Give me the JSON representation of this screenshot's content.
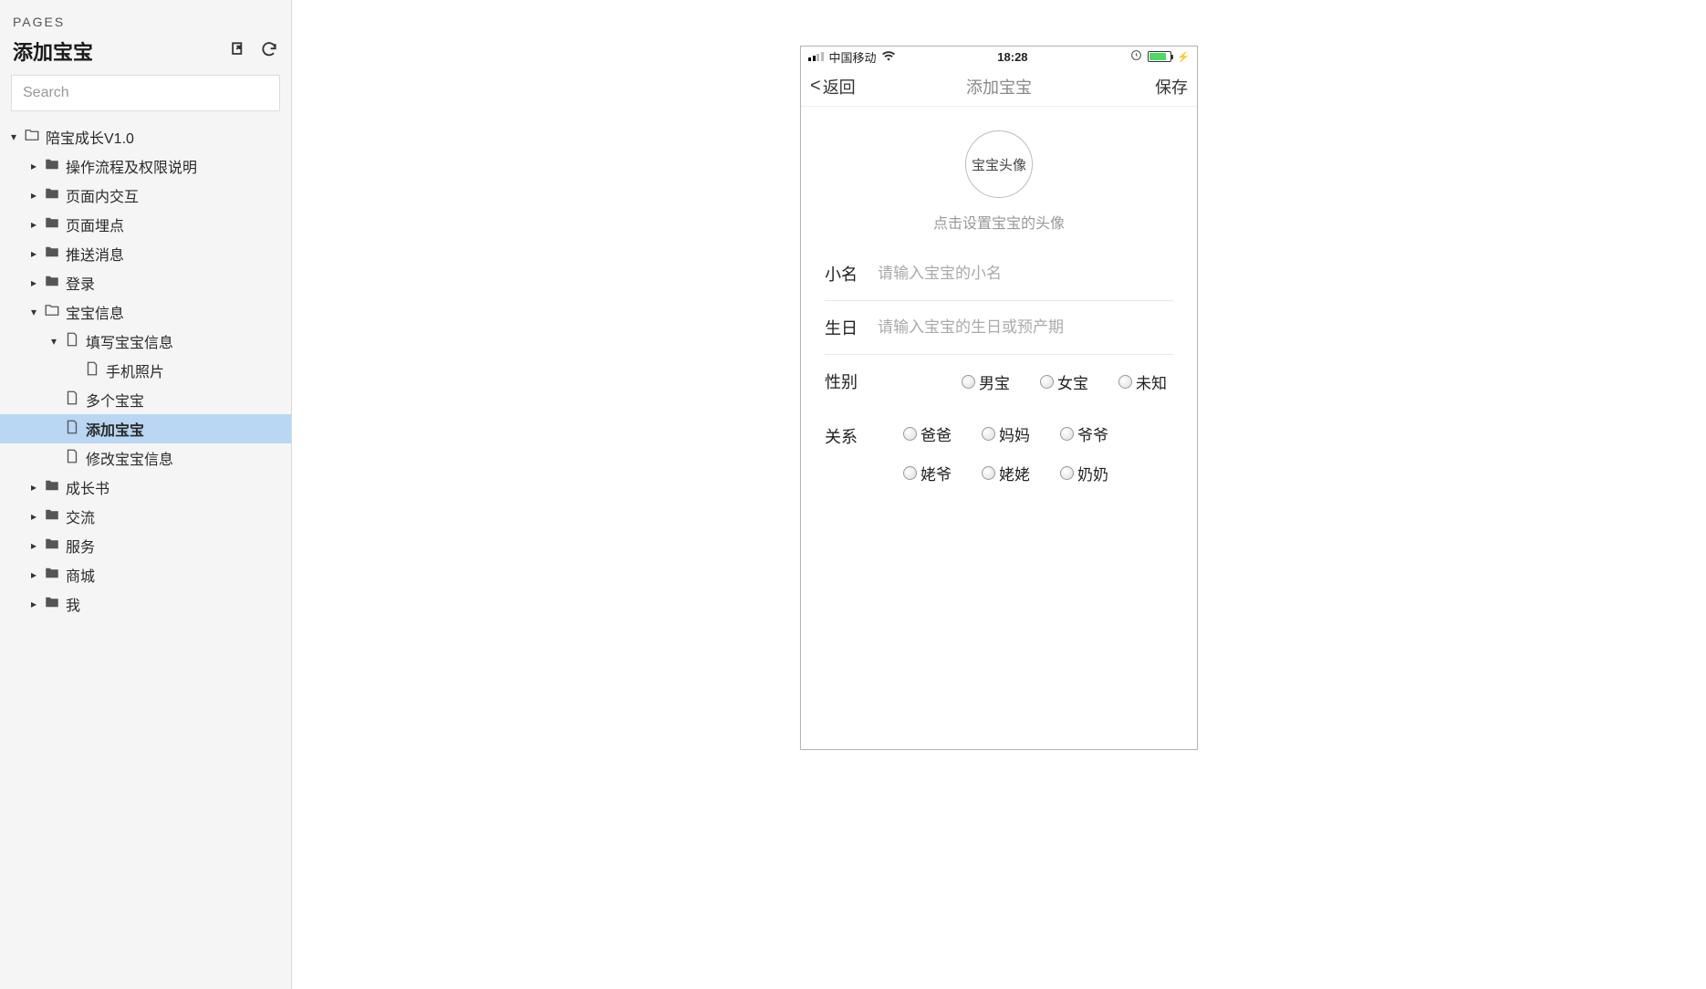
{
  "sidebar": {
    "pages_label": "PAGES",
    "page_title": "添加宝宝",
    "search_placeholder": "Search",
    "tree": [
      {
        "indent": 0,
        "caret": "down",
        "icon": "folder-outline",
        "label": "陪宝成长V1.0"
      },
      {
        "indent": 1,
        "caret": "right",
        "icon": "folder",
        "label": "操作流程及权限说明"
      },
      {
        "indent": 1,
        "caret": "right",
        "icon": "folder",
        "label": "页面内交互"
      },
      {
        "indent": 1,
        "caret": "right",
        "icon": "folder",
        "label": "页面埋点"
      },
      {
        "indent": 1,
        "caret": "right",
        "icon": "folder",
        "label": "推送消息"
      },
      {
        "indent": 1,
        "caret": "right",
        "icon": "folder",
        "label": "登录"
      },
      {
        "indent": 1,
        "caret": "down",
        "icon": "folder-outline",
        "label": "宝宝信息"
      },
      {
        "indent": 2,
        "caret": "down",
        "icon": "page",
        "label": "填写宝宝信息"
      },
      {
        "indent": 3,
        "caret": "blank",
        "icon": "page",
        "label": "手机照片"
      },
      {
        "indent": 2,
        "caret": "blank",
        "icon": "page",
        "label": "多个宝宝"
      },
      {
        "indent": 2,
        "caret": "blank",
        "icon": "page",
        "label": "添加宝宝",
        "selected": true,
        "bold": true
      },
      {
        "indent": 2,
        "caret": "blank",
        "icon": "page",
        "label": "修改宝宝信息"
      },
      {
        "indent": 1,
        "caret": "right",
        "icon": "folder",
        "label": "成长书"
      },
      {
        "indent": 1,
        "caret": "right",
        "icon": "folder",
        "label": "交流"
      },
      {
        "indent": 1,
        "caret": "right",
        "icon": "folder",
        "label": "服务"
      },
      {
        "indent": 1,
        "caret": "right",
        "icon": "folder",
        "label": "商城"
      },
      {
        "indent": 1,
        "caret": "right",
        "icon": "folder",
        "label": "我"
      }
    ]
  },
  "mockup": {
    "status": {
      "carrier": "中国移动",
      "time": "18:28"
    },
    "nav": {
      "back": "返回",
      "title": "添加宝宝",
      "save": "保存"
    },
    "avatar": {
      "label": "宝宝头像",
      "hint": "点击设置宝宝的头像"
    },
    "form": {
      "nickname_label": "小名",
      "nickname_placeholder": "请输入宝宝的小名",
      "birthday_label": "生日",
      "birthday_placeholder": "请输入宝宝的生日或预产期",
      "gender_label": "性别",
      "gender_options": [
        "男宝",
        "女宝",
        "未知"
      ],
      "relation_label": "关系",
      "relation_options": [
        "爸爸",
        "妈妈",
        "爷爷",
        "姥爷",
        "姥姥",
        "奶奶"
      ]
    }
  }
}
